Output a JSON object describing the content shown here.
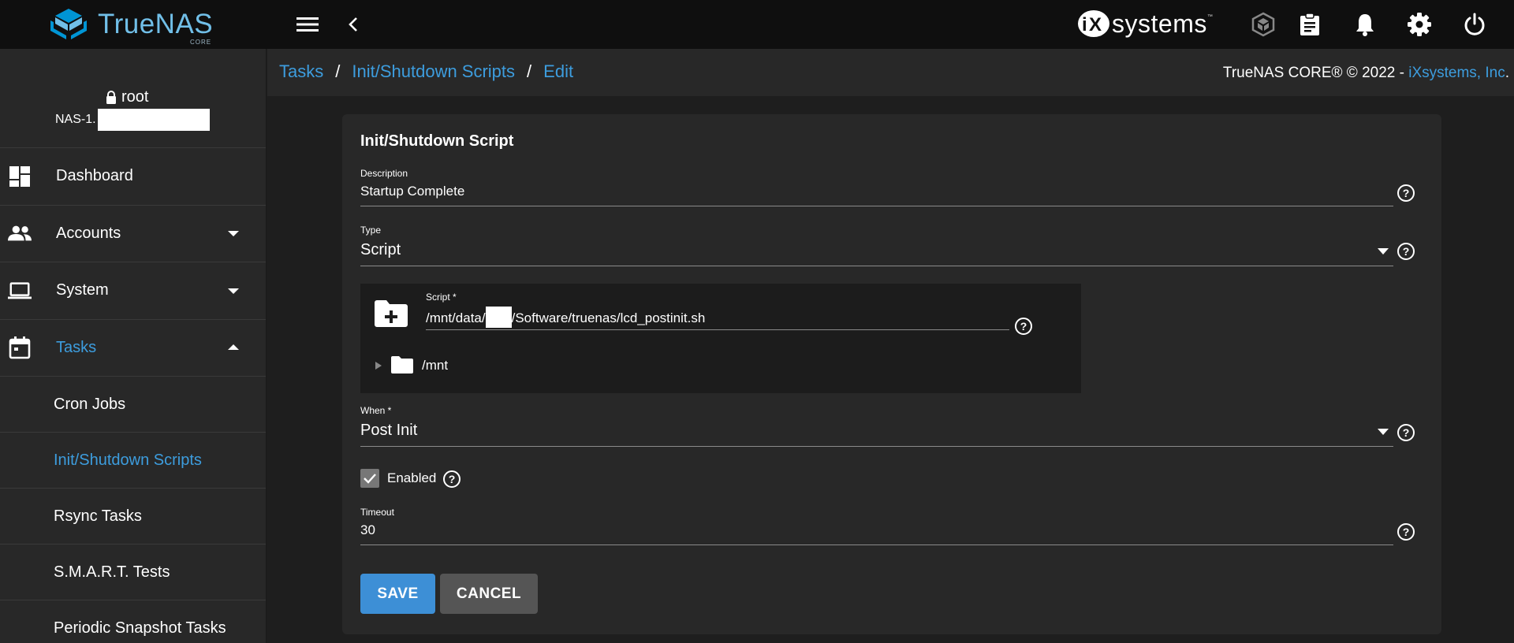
{
  "topbar": {
    "brand_name": "TrueNAS",
    "brand_edition": "CORE",
    "vendor_name": "systems",
    "vendor_tm": "™",
    "icons": [
      "menu-icon",
      "back-chevron-icon",
      "truecommand-icon",
      "task-manager-icon",
      "notifications-bell-icon",
      "settings-gear-icon",
      "power-icon"
    ]
  },
  "sidebar": {
    "user": "root",
    "hostname_prefix": "NAS-1.",
    "items": [
      {
        "label": "Dashboard",
        "icon": "dashboard-icon"
      },
      {
        "label": "Accounts",
        "icon": "accounts-icon",
        "expand": "down"
      },
      {
        "label": "System",
        "icon": "laptop-icon",
        "expand": "down"
      },
      {
        "label": "Tasks",
        "icon": "calendar-icon",
        "expand": "up",
        "active": true
      }
    ],
    "subitems": [
      {
        "label": "Cron Jobs"
      },
      {
        "label": "Init/Shutdown Scripts",
        "active": true
      },
      {
        "label": "Rsync Tasks"
      },
      {
        "label": "S.M.A.R.T. Tests"
      },
      {
        "label": "Periodic Snapshot Tasks"
      }
    ]
  },
  "breadcrumb": {
    "items": [
      "Tasks",
      "Init/Shutdown Scripts",
      "Edit"
    ],
    "separator": "/"
  },
  "copyright": {
    "text": "TrueNAS CORE® © 2022 - ",
    "link": "iXsystems, Inc",
    "suffix": "."
  },
  "form": {
    "title": "Init/Shutdown Script",
    "description": {
      "label": "Description",
      "value": "Startup Complete"
    },
    "type": {
      "label": "Type",
      "value": "Script"
    },
    "script": {
      "label": "Script *",
      "value_prefix": "/mnt/data/",
      "value_suffix": "/Software/truenas/lcd_postinit.sh",
      "tree_root": "/mnt"
    },
    "when": {
      "label": "When *",
      "value": "Post Init"
    },
    "enabled": {
      "label": "Enabled",
      "checked": true
    },
    "timeout": {
      "label": "Timeout",
      "value": "30"
    },
    "save_label": "SAVE",
    "cancel_label": "CANCEL"
  },
  "colors": {
    "accent": "#3d9dde",
    "logo": "#71bfe8",
    "save_button": "#3d8fd6",
    "cancel_button": "#555555"
  }
}
